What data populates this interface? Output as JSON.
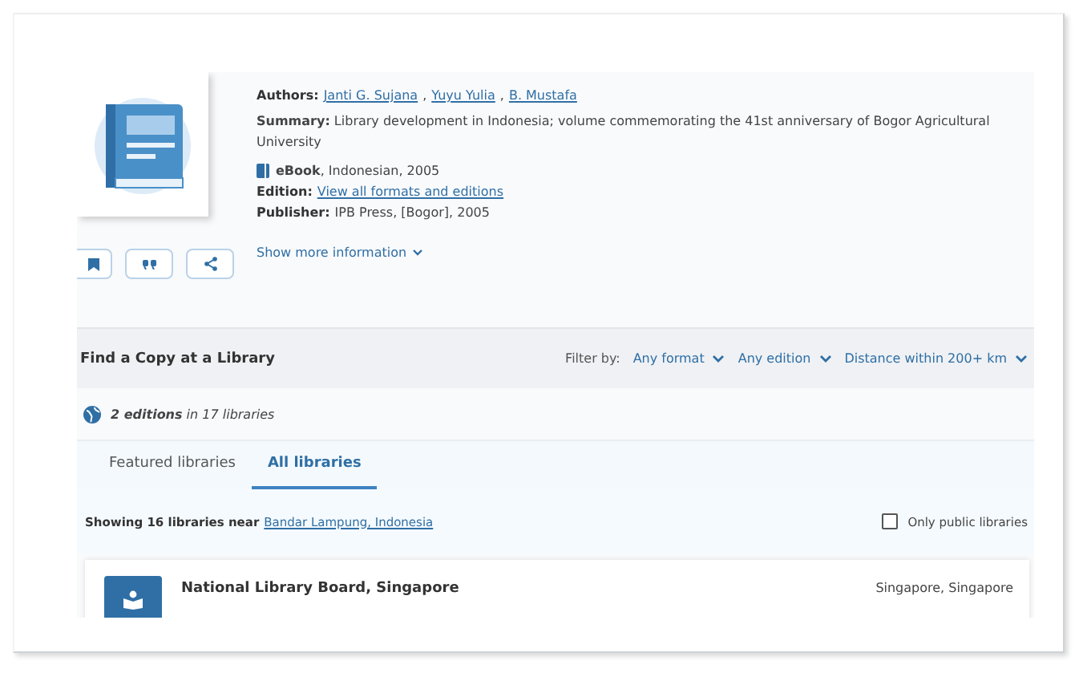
{
  "record": {
    "authors_label": "Authors:",
    "authors": [
      "Janti G. Sujana",
      "Yuyu Yulia",
      "B. Mustafa"
    ],
    "author_separator": ",",
    "summary": "**Summary:** Library development in Indonesia; volume commemorating the 41st anniversary of Bogor Agricultural University",
    "format": "eBook",
    "format_detail": ", Indonesian, 2005",
    "edition_label": "Edition:",
    "edition_link": "View all formats and editions",
    "publisher_label": "Publisher:",
    "publisher": "IPB Press, [Bogor], 2005",
    "show_more": "Show more information"
  },
  "find_copy": {
    "title": "Find a Copy at a Library",
    "filter_label": "Filter by:",
    "filters": [
      "Any format",
      "Any edition",
      "Distance within 200+ km"
    ],
    "editions": "**2 editions** in 17 libraries",
    "tabs": [
      {
        "label": "Featured libraries",
        "selected": false
      },
      {
        "label": "All libraries",
        "selected": true
      }
    ],
    "showing": "Showing 16 libraries near",
    "location": "Bandar Lampung, Indonesia",
    "only_public": {
      "label": "Only public libraries",
      "checked": false
    },
    "libraries": [
      {
        "name": "National Library Board, Singapore",
        "place": "Singapore, Singapore"
      }
    ]
  }
}
